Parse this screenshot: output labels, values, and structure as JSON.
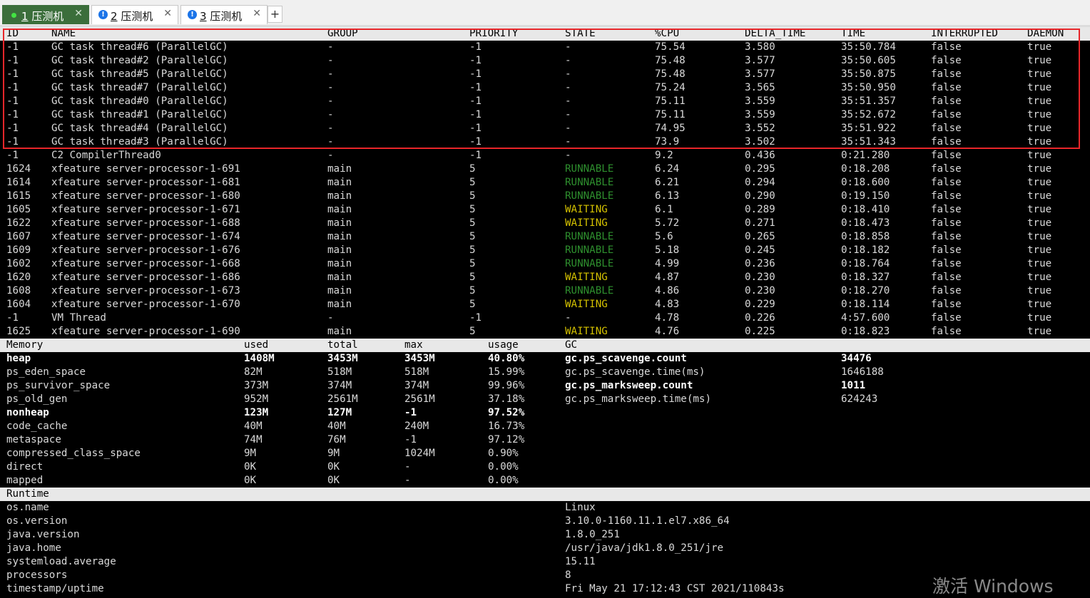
{
  "tabs": [
    {
      "num": "1",
      "name": "压测机",
      "active": true,
      "status": "connected",
      "close": "✕"
    },
    {
      "num": "2",
      "name": "压测机",
      "active": false,
      "status": "warning",
      "close": "✕"
    },
    {
      "num": "3",
      "name": "压测机",
      "active": false,
      "status": "warning",
      "close": "✕"
    }
  ],
  "add_tab_label": "+",
  "threads": {
    "headers": [
      "ID",
      "NAME",
      "GROUP",
      "PRIORITY",
      "STATE",
      "%CPU",
      "DELTA_TIME",
      "TIME",
      "INTERRUPTED",
      "DAEMON"
    ],
    "rows": [
      [
        "-1",
        "GC task thread#6 (ParallelGC)",
        "-",
        "-1",
        "-",
        "75.54",
        "3.580",
        "35:50.784",
        "false",
        "true"
      ],
      [
        "-1",
        "GC task thread#2 (ParallelGC)",
        "-",
        "-1",
        "-",
        "75.48",
        "3.577",
        "35:50.605",
        "false",
        "true"
      ],
      [
        "-1",
        "GC task thread#5 (ParallelGC)",
        "-",
        "-1",
        "-",
        "75.48",
        "3.577",
        "35:50.875",
        "false",
        "true"
      ],
      [
        "-1",
        "GC task thread#7 (ParallelGC)",
        "-",
        "-1",
        "-",
        "75.24",
        "3.565",
        "35:50.950",
        "false",
        "true"
      ],
      [
        "-1",
        "GC task thread#0 (ParallelGC)",
        "-",
        "-1",
        "-",
        "75.11",
        "3.559",
        "35:51.357",
        "false",
        "true"
      ],
      [
        "-1",
        "GC task thread#1 (ParallelGC)",
        "-",
        "-1",
        "-",
        "75.11",
        "3.559",
        "35:52.672",
        "false",
        "true"
      ],
      [
        "-1",
        "GC task thread#4 (ParallelGC)",
        "-",
        "-1",
        "-",
        "74.95",
        "3.552",
        "35:51.922",
        "false",
        "true"
      ],
      [
        "-1",
        "GC task thread#3 (ParallelGC)",
        "-",
        "-1",
        "-",
        "73.9",
        "3.502",
        "35:51.343",
        "false",
        "true"
      ],
      [
        "-1",
        "C2 CompilerThread0",
        "-",
        "-1",
        "-",
        "9.2",
        "0.436",
        "0:21.280",
        "false",
        "true"
      ],
      [
        "1624",
        "xfeature server-processor-1-691",
        "main",
        "5",
        "RUNNABLE",
        "6.24",
        "0.295",
        "0:18.208",
        "false",
        "true"
      ],
      [
        "1614",
        "xfeature server-processor-1-681",
        "main",
        "5",
        "RUNNABLE",
        "6.21",
        "0.294",
        "0:18.600",
        "false",
        "true"
      ],
      [
        "1615",
        "xfeature server-processor-1-680",
        "main",
        "5",
        "RUNNABLE",
        "6.13",
        "0.290",
        "0:19.150",
        "false",
        "true"
      ],
      [
        "1605",
        "xfeature server-processor-1-671",
        "main",
        "5",
        "WAITING",
        "6.1",
        "0.289",
        "0:18.410",
        "false",
        "true"
      ],
      [
        "1622",
        "xfeature server-processor-1-688",
        "main",
        "5",
        "WAITING",
        "5.72",
        "0.271",
        "0:18.473",
        "false",
        "true"
      ],
      [
        "1607",
        "xfeature server-processor-1-674",
        "main",
        "5",
        "RUNNABLE",
        "5.6",
        "0.265",
        "0:18.858",
        "false",
        "true"
      ],
      [
        "1609",
        "xfeature server-processor-1-676",
        "main",
        "5",
        "RUNNABLE",
        "5.18",
        "0.245",
        "0:18.182",
        "false",
        "true"
      ],
      [
        "1602",
        "xfeature server-processor-1-668",
        "main",
        "5",
        "RUNNABLE",
        "4.99",
        "0.236",
        "0:18.764",
        "false",
        "true"
      ],
      [
        "1620",
        "xfeature server-processor-1-686",
        "main",
        "5",
        "WAITING",
        "4.87",
        "0.230",
        "0:18.327",
        "false",
        "true"
      ],
      [
        "1608",
        "xfeature server-processor-1-673",
        "main",
        "5",
        "RUNNABLE",
        "4.86",
        "0.230",
        "0:18.270",
        "false",
        "true"
      ],
      [
        "1604",
        "xfeature server-processor-1-670",
        "main",
        "5",
        "WAITING",
        "4.83",
        "0.229",
        "0:18.114",
        "false",
        "true"
      ],
      [
        "-1",
        "VM Thread",
        "-",
        "-1",
        "-",
        "4.78",
        "0.226",
        "4:57.600",
        "false",
        "true"
      ],
      [
        "1625",
        "xfeature server-processor-1-690",
        "main",
        "5",
        "WAITING",
        "4.76",
        "0.225",
        "0:18.823",
        "false",
        "true"
      ]
    ],
    "state_colors": {
      "RUNNABLE": "#2e8f2e",
      "WAITING": "#d4c100"
    },
    "highlight_color": "#e8262a"
  },
  "memory": {
    "headers": [
      "Memory",
      "used",
      "total",
      "max",
      "usage"
    ],
    "rows": [
      {
        "cells": [
          "heap",
          "1408M",
          "3453M",
          "3453M",
          "40.80%"
        ],
        "bold": true
      },
      {
        "cells": [
          "ps_eden_space",
          "82M",
          "518M",
          "518M",
          "15.99%"
        ],
        "bold": false
      },
      {
        "cells": [
          "ps_survivor_space",
          "373M",
          "374M",
          "374M",
          "99.96%"
        ],
        "bold": false
      },
      {
        "cells": [
          "ps_old_gen",
          "952M",
          "2561M",
          "2561M",
          "37.18%"
        ],
        "bold": false
      },
      {
        "cells": [
          "nonheap",
          "123M",
          "127M",
          "-1",
          "97.52%"
        ],
        "bold": true
      },
      {
        "cells": [
          "code_cache",
          "40M",
          "40M",
          "240M",
          "16.73%"
        ],
        "bold": false
      },
      {
        "cells": [
          "metaspace",
          "74M",
          "76M",
          "-1",
          "97.12%"
        ],
        "bold": false
      },
      {
        "cells": [
          "compressed_class_space",
          "9M",
          "9M",
          "1024M",
          "0.90%"
        ],
        "bold": false
      },
      {
        "cells": [
          "direct",
          "0K",
          "0K",
          "-",
          "0.00%"
        ],
        "bold": false
      },
      {
        "cells": [
          "mapped",
          "0K",
          "0K",
          "-",
          "0.00%"
        ],
        "bold": false
      }
    ]
  },
  "gc": {
    "header": "GC",
    "rows": [
      {
        "key": "gc.ps_scavenge.count",
        "value": "34476",
        "bold": true
      },
      {
        "key": "gc.ps_scavenge.time(ms)",
        "value": "1646188",
        "bold": false
      },
      {
        "key": "gc.ps_marksweep.count",
        "value": "1011",
        "bold": true
      },
      {
        "key": "gc.ps_marksweep.time(ms)",
        "value": "624243",
        "bold": false
      }
    ]
  },
  "runtime": {
    "header": "Runtime",
    "rows": [
      [
        "os.name",
        "Linux"
      ],
      [
        "os.version",
        "3.10.0-1160.11.1.el7.x86_64"
      ],
      [
        "java.version",
        "1.8.0_251"
      ],
      [
        "java.home",
        "/usr/java/jdk1.8.0_251/jre"
      ],
      [
        "systemload.average",
        "15.11"
      ],
      [
        "processors",
        "8"
      ],
      [
        "timestamp/uptime",
        "Fri May 21 17:12:43 CST 2021/110843s"
      ]
    ]
  },
  "watermark": "激活 Windows"
}
